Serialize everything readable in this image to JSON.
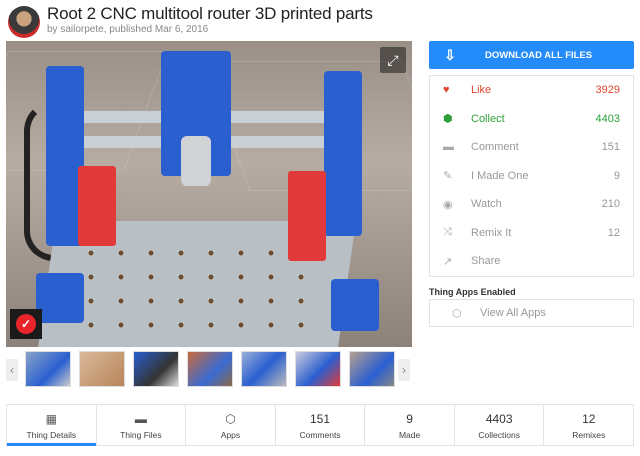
{
  "header": {
    "title": "Root 2 CNC multitool router 3D printed parts",
    "byline": "by sailorpete, published Mar 6, 2016"
  },
  "image": {
    "expand_icon": "expand-icon",
    "badge_icon": "remix-check-icon"
  },
  "thumbnails": {
    "prev": "‹",
    "next": "›",
    "count": 7
  },
  "download": {
    "label": "DOWNLOAD ALL FILES",
    "icon": "download-icon"
  },
  "actions": [
    {
      "label": "Like",
      "count": "3929",
      "icon": "heart-icon",
      "color": "#e2452e"
    },
    {
      "label": "Collect",
      "count": "4403",
      "icon": "collect-cube-icon",
      "color": "#2ea03a"
    },
    {
      "label": "Comment",
      "count": "151",
      "icon": "comment-icon"
    },
    {
      "label": "I Made One",
      "count": "9",
      "icon": "edit-icon"
    },
    {
      "label": "Watch",
      "count": "210",
      "icon": "eye-icon"
    },
    {
      "label": "Remix It",
      "count": "12",
      "icon": "shuffle-icon"
    },
    {
      "label": "Share",
      "count": "",
      "icon": "share-icon"
    }
  ],
  "apps": {
    "title": "Thing Apps Enabled",
    "view_all": "View All Apps"
  },
  "tabs": [
    {
      "label": "Thing Details",
      "value": "",
      "icon": "details-icon",
      "active": true
    },
    {
      "label": "Thing Files",
      "value": "",
      "icon": "folder-icon"
    },
    {
      "label": "Apps",
      "value": "",
      "icon": "cube-icon"
    },
    {
      "label": "Comments",
      "value": "151"
    },
    {
      "label": "Made",
      "value": "9"
    },
    {
      "label": "Collections",
      "value": "4403"
    },
    {
      "label": "Remixes",
      "value": "12"
    }
  ],
  "colors": {
    "accent": "#248bfb",
    "like": "#e2452e",
    "collect": "#2ea03a"
  }
}
